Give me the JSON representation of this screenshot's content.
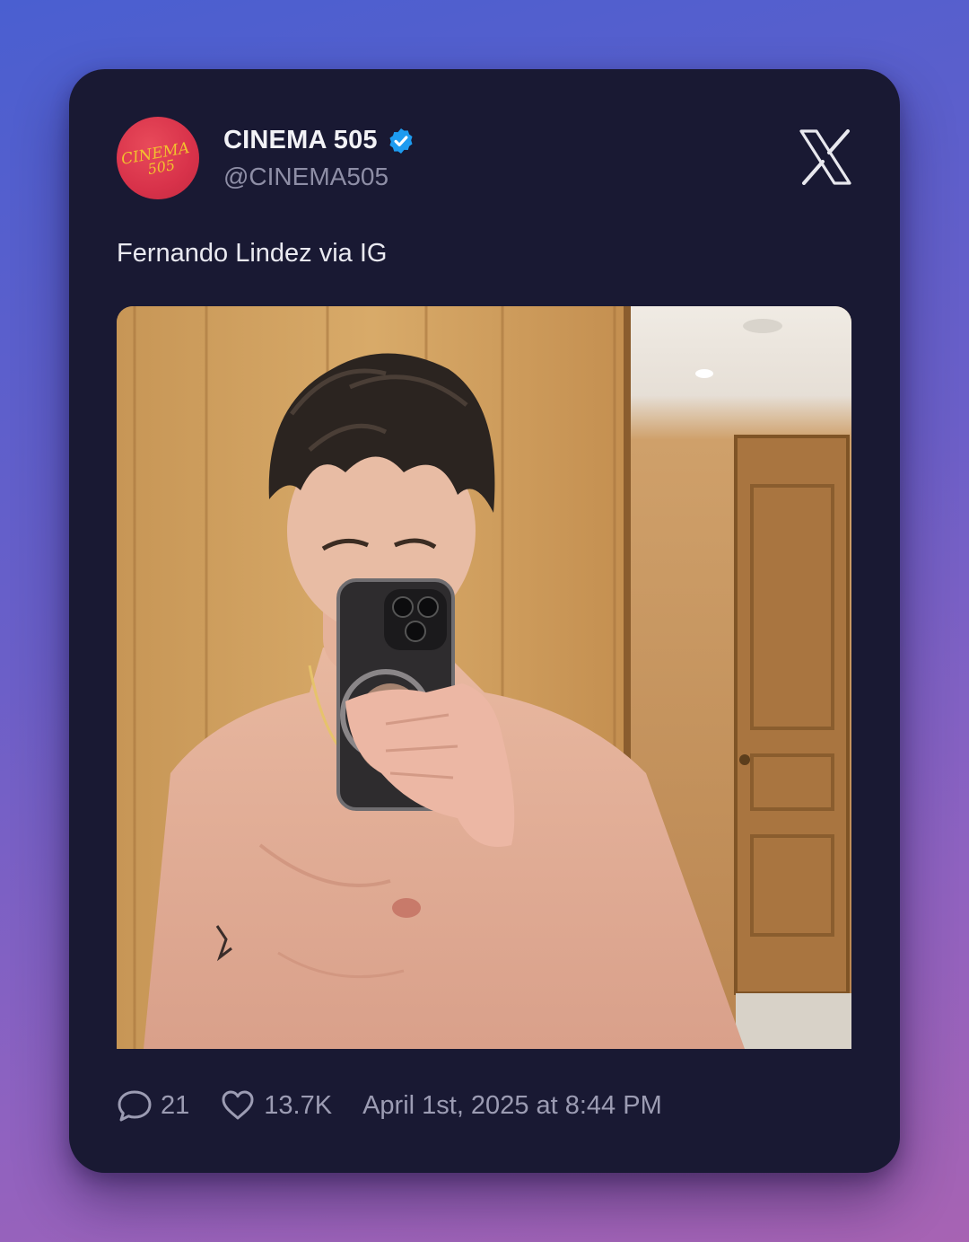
{
  "author": {
    "display_name": "CINEMA 505",
    "handle": "@CINEMA505",
    "verified": true,
    "avatar_text": [
      "CINEMA",
      "505"
    ],
    "avatar_color": "#d8324a"
  },
  "tweet": {
    "text": "Fernando Lindez via IG",
    "media": {
      "type": "photo"
    }
  },
  "stats": {
    "replies": "21",
    "likes": "13.7K",
    "timestamp": "April 1st, 2025 at 8:44 PM"
  },
  "icons": {
    "reply": "comment-bubble-icon",
    "like": "heart-icon",
    "verified": "verified-badge-icon",
    "brand": "x-logo-icon"
  },
  "colors": {
    "card_background": "#191933",
    "verified_blue": "#1d9bf0",
    "name_text": "#f2f2f6",
    "muted_text": "#9c9cb3"
  }
}
